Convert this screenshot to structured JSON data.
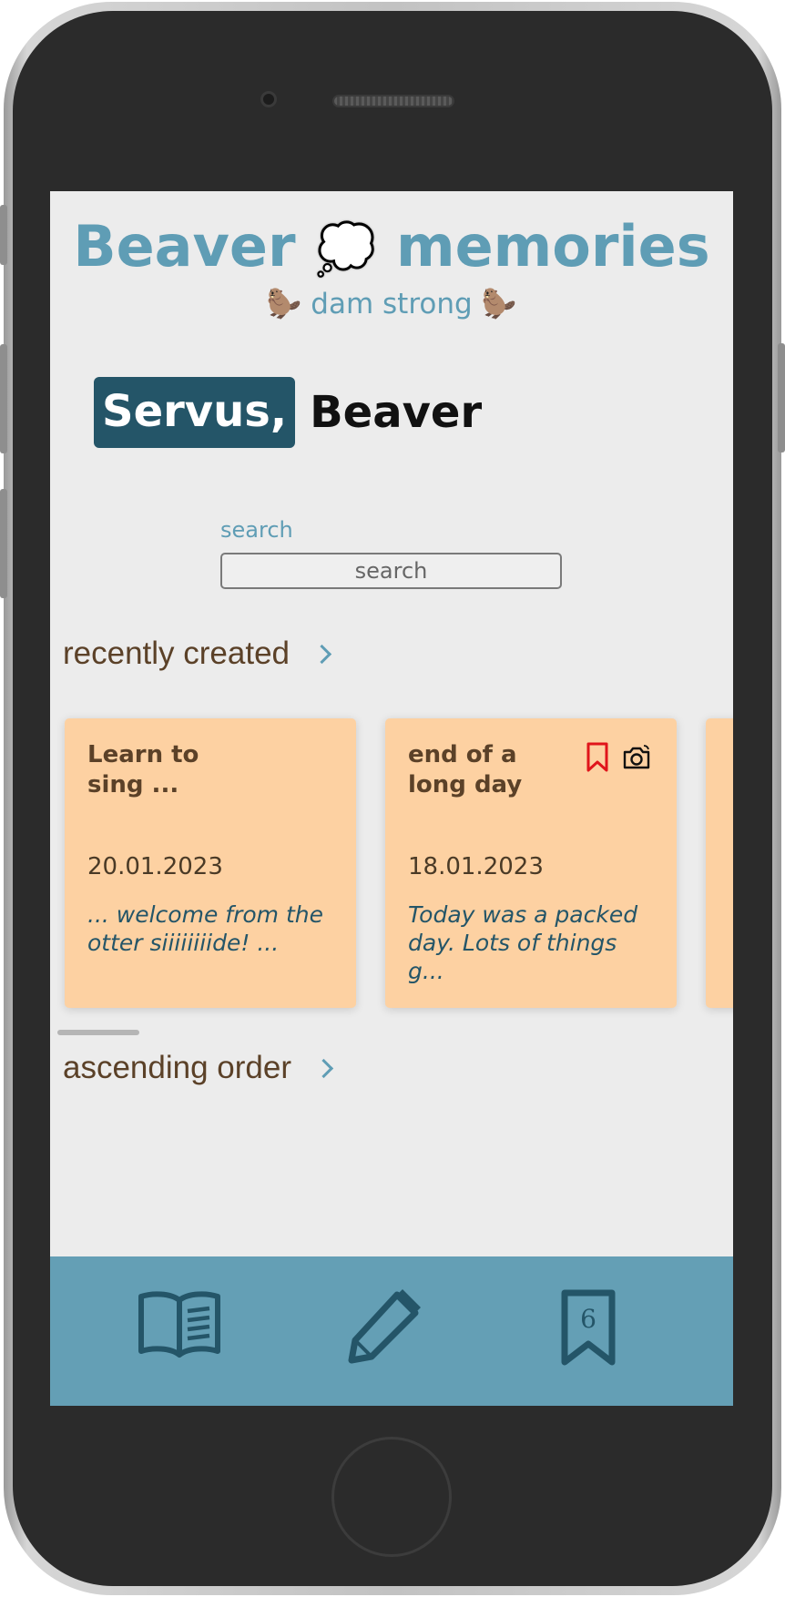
{
  "app": {
    "title_left": "Beaver",
    "title_emoji": "💭",
    "title_right": "memories",
    "subtitle_left_emoji": "🦫",
    "subtitle": "dam strong",
    "subtitle_right_emoji": "🦫"
  },
  "greeting": {
    "salutation": "Servus,",
    "name": "Beaver"
  },
  "search": {
    "label": "search",
    "placeholder": "search"
  },
  "sections": {
    "recently_created": "recently created",
    "ascending_order": "ascending order"
  },
  "cards": [
    {
      "title": "Learn to sing ...",
      "date": "20.01.2023",
      "snippet": "... welcome from the otter siiiiiiiide! ...",
      "bookmarked": false,
      "has_photo": false
    },
    {
      "title": "end of a long day",
      "date": "18.01.2023",
      "snippet": "Today was a packed day. Lots of things g...",
      "bookmarked": true,
      "has_photo": true
    }
  ],
  "tabbar": {
    "items": [
      {
        "icon": "book-open-icon"
      },
      {
        "icon": "pencil-icon"
      },
      {
        "icon": "bookmark-icon",
        "badge": "6"
      }
    ],
    "background": "#649fb5",
    "icon_color": "#245568"
  },
  "colors": {
    "accent": "#5f9db5",
    "dark_accent": "#245568",
    "card_bg": "#fdd1a2",
    "heading_brown": "#5b4128",
    "bookmark_red": "#e0151b"
  }
}
